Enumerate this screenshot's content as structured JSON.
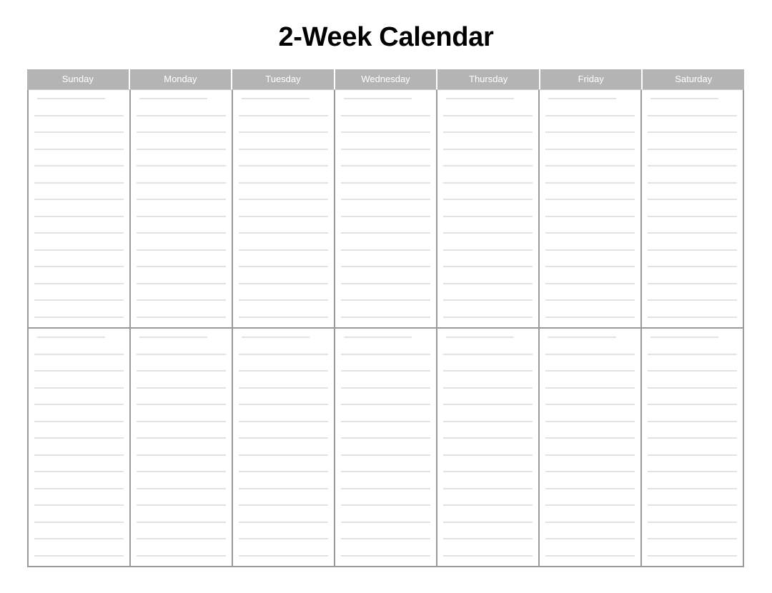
{
  "document": {
    "title": "2-Week Calendar"
  },
  "calendar": {
    "columns": [
      {
        "label": "Sunday"
      },
      {
        "label": "Monday"
      },
      {
        "label": "Tuesday"
      },
      {
        "label": "Wednesday"
      },
      {
        "label": "Thursday"
      },
      {
        "label": "Friday"
      },
      {
        "label": "Saturday"
      }
    ],
    "weeks": [
      {
        "name": "week-1",
        "days": [
          {
            "day": "Sunday",
            "date_line": "",
            "entry_lines": [
              "",
              "",
              "",
              "",
              "",
              "",
              "",
              "",
              "",
              "",
              "",
              "",
              ""
            ]
          },
          {
            "day": "Monday",
            "date_line": "",
            "entry_lines": [
              "",
              "",
              "",
              "",
              "",
              "",
              "",
              "",
              "",
              "",
              "",
              "",
              ""
            ]
          },
          {
            "day": "Tuesday",
            "date_line": "",
            "entry_lines": [
              "",
              "",
              "",
              "",
              "",
              "",
              "",
              "",
              "",
              "",
              "",
              "",
              ""
            ]
          },
          {
            "day": "Wednesday",
            "date_line": "",
            "entry_lines": [
              "",
              "",
              "",
              "",
              "",
              "",
              "",
              "",
              "",
              "",
              "",
              "",
              ""
            ]
          },
          {
            "day": "Thursday",
            "date_line": "",
            "entry_lines": [
              "",
              "",
              "",
              "",
              "",
              "",
              "",
              "",
              "",
              "",
              "",
              "",
              ""
            ]
          },
          {
            "day": "Friday",
            "date_line": "",
            "entry_lines": [
              "",
              "",
              "",
              "",
              "",
              "",
              "",
              "",
              "",
              "",
              "",
              "",
              ""
            ]
          },
          {
            "day": "Saturday",
            "date_line": "",
            "entry_lines": [
              "",
              "",
              "",
              "",
              "",
              "",
              "",
              "",
              "",
              "",
              "",
              "",
              ""
            ]
          }
        ]
      },
      {
        "name": "week-2",
        "days": [
          {
            "day": "Sunday",
            "date_line": "",
            "entry_lines": [
              "",
              "",
              "",
              "",
              "",
              "",
              "",
              "",
              "",
              "",
              "",
              "",
              ""
            ]
          },
          {
            "day": "Monday",
            "date_line": "",
            "entry_lines": [
              "",
              "",
              "",
              "",
              "",
              "",
              "",
              "",
              "",
              "",
              "",
              "",
              ""
            ]
          },
          {
            "day": "Tuesday",
            "date_line": "",
            "entry_lines": [
              "",
              "",
              "",
              "",
              "",
              "",
              "",
              "",
              "",
              "",
              "",
              "",
              ""
            ]
          },
          {
            "day": "Wednesday",
            "date_line": "",
            "entry_lines": [
              "",
              "",
              "",
              "",
              "",
              "",
              "",
              "",
              "",
              "",
              "",
              "",
              ""
            ]
          },
          {
            "day": "Thursday",
            "date_line": "",
            "entry_lines": [
              "",
              "",
              "",
              "",
              "",
              "",
              "",
              "",
              "",
              "",
              "",
              "",
              ""
            ]
          },
          {
            "day": "Friday",
            "date_line": "",
            "entry_lines": [
              "",
              "",
              "",
              "",
              "",
              "",
              "",
              "",
              "",
              "",
              "",
              "",
              ""
            ]
          },
          {
            "day": "Saturday",
            "date_line": "",
            "entry_lines": [
              "",
              "",
              "",
              "",
              "",
              "",
              "",
              "",
              "",
              "",
              "",
              "",
              ""
            ]
          }
        ]
      }
    ]
  },
  "style": {
    "header_background": "#b4b4b4",
    "header_text_color": "#ffffff",
    "grid_border_color": "#9a9a9a",
    "rule_line_color": "#e2e2e2",
    "page_background": "#ffffff",
    "title_color": "#000000"
  }
}
